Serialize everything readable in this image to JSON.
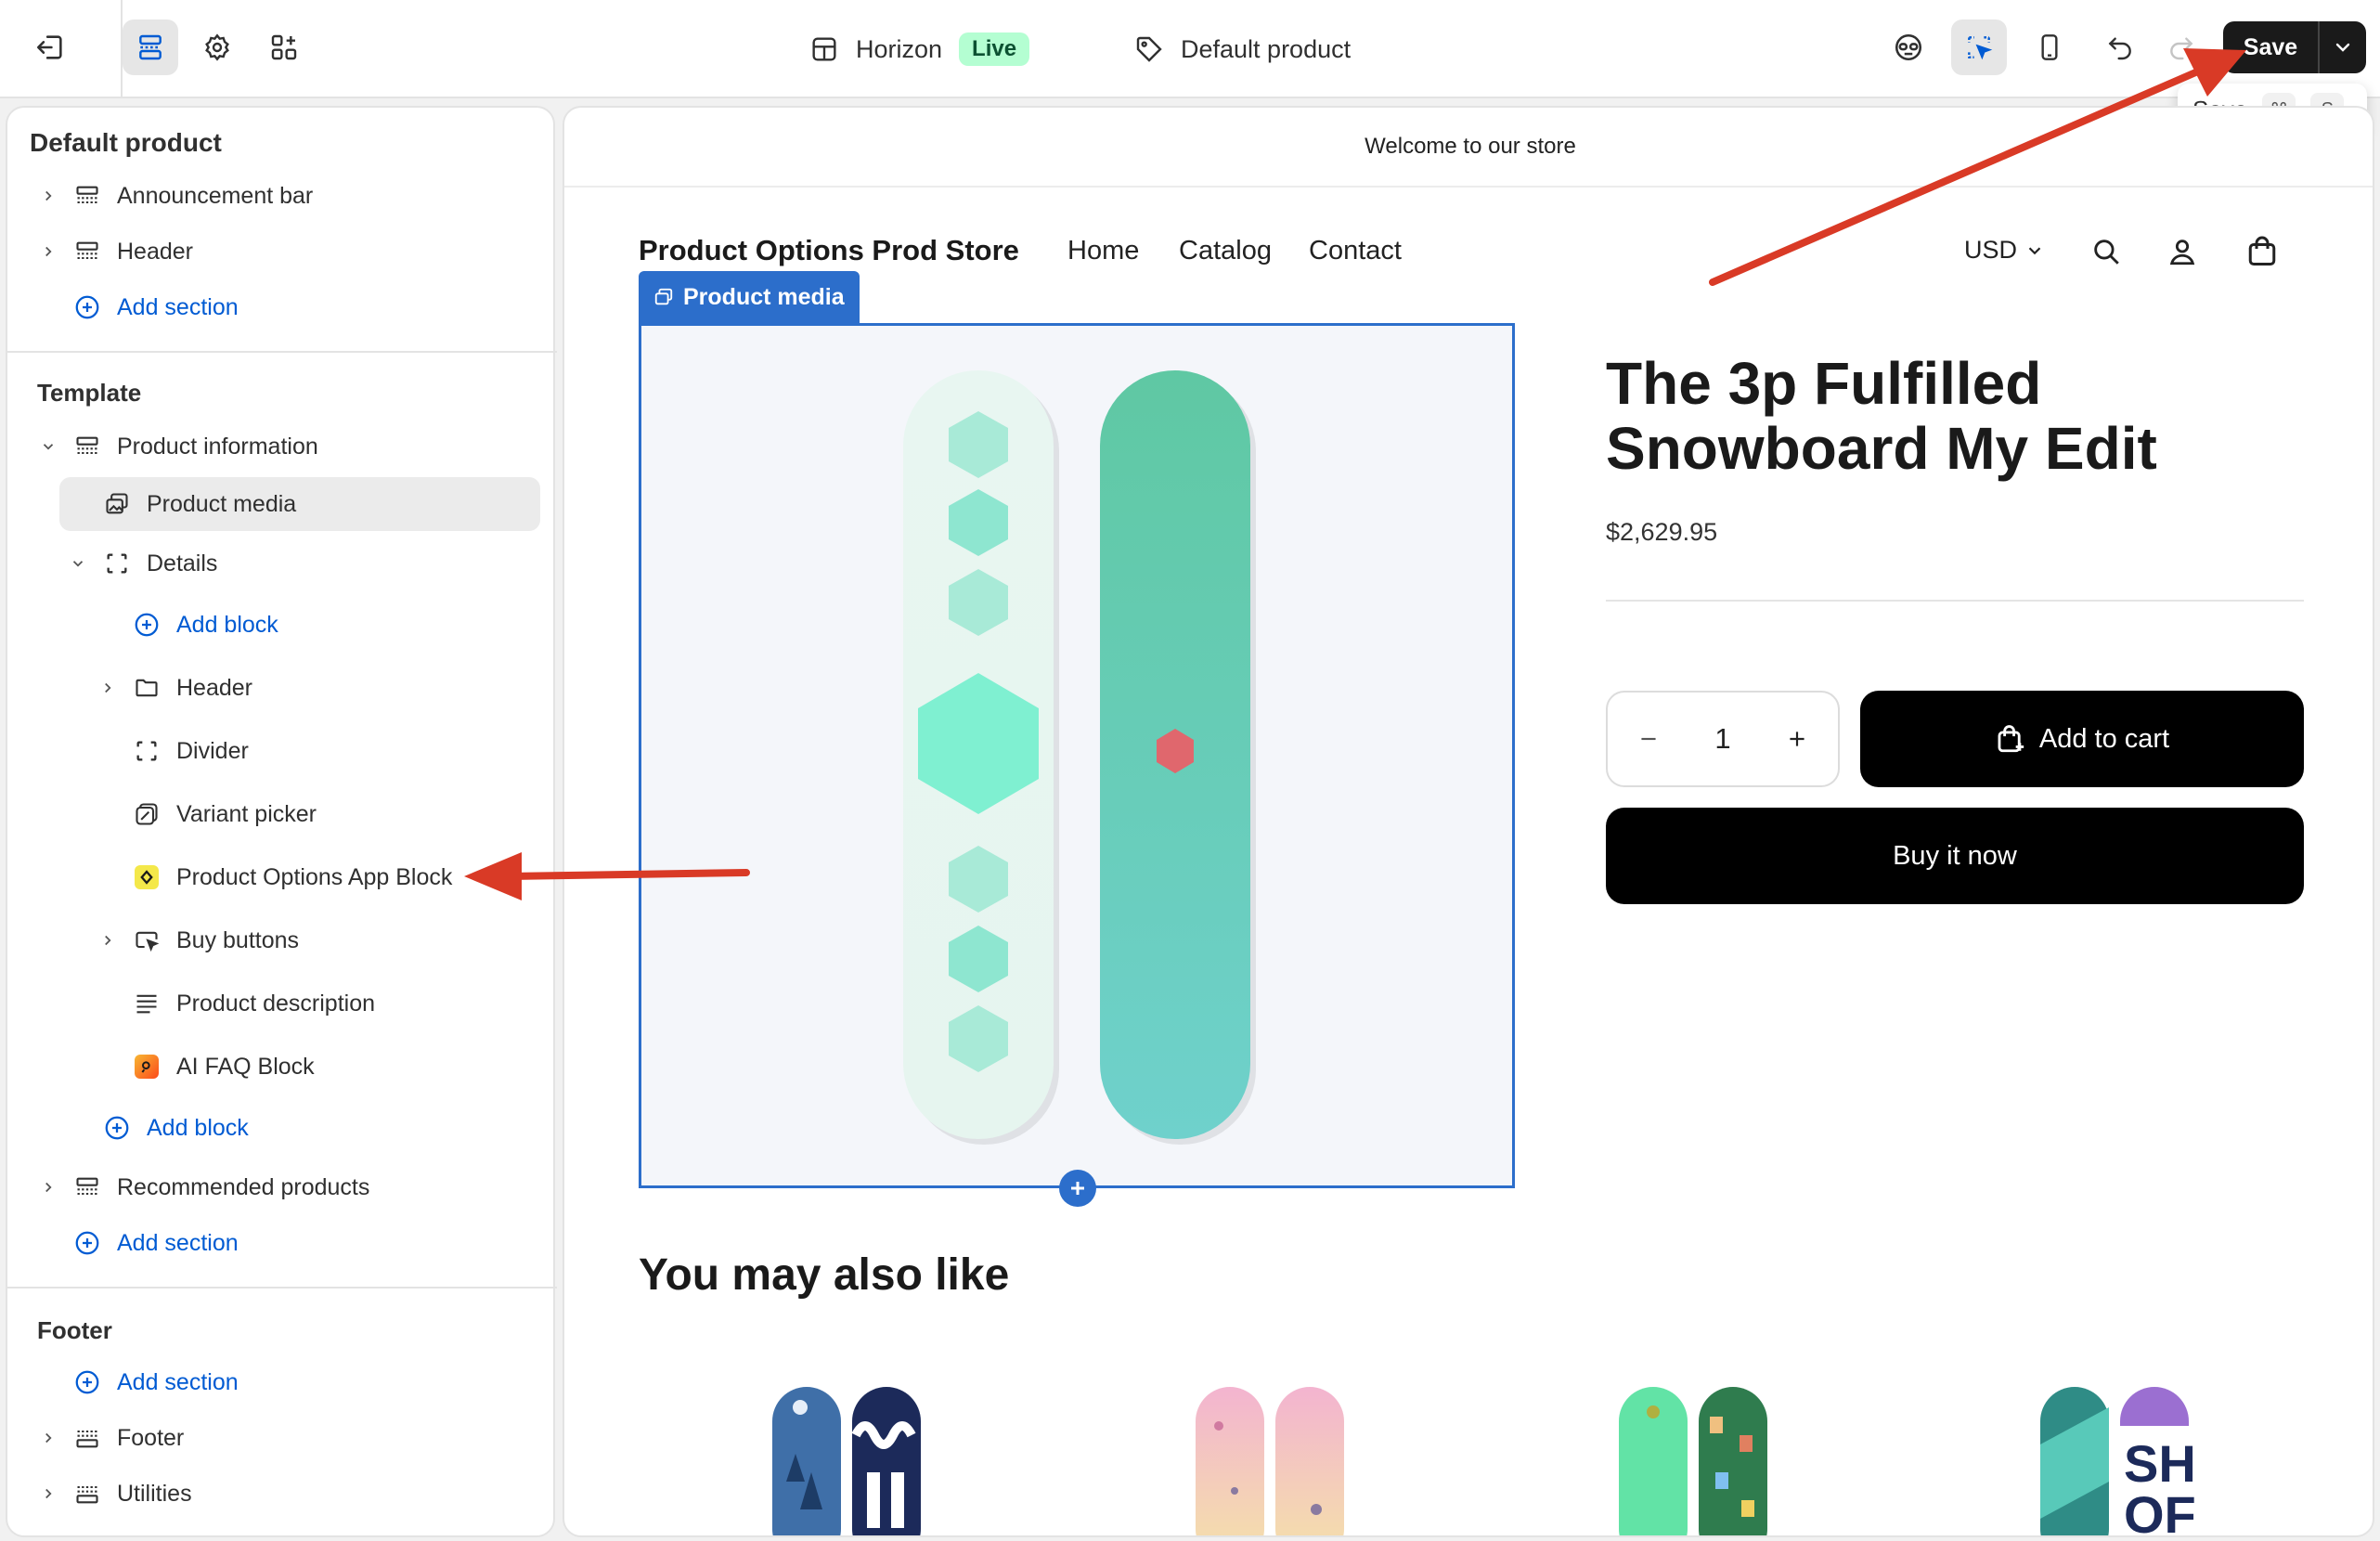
{
  "topbar": {
    "theme_name": "Horizon",
    "theme_status": "Live",
    "template_name": "Default product",
    "save_label": "Save",
    "tooltip": {
      "label": "Save",
      "key_cmd": "⌘",
      "key_s": "S"
    }
  },
  "sidebar": {
    "title": "Default product",
    "header_group": {
      "items": [
        {
          "label": "Announcement bar"
        },
        {
          "label": "Header"
        }
      ],
      "add_label": "Add section"
    },
    "template": {
      "heading": "Template",
      "product_information": "Product information",
      "product_media": "Product media",
      "details": "Details",
      "add_block_inner": "Add block",
      "blocks": [
        {
          "label": "Header"
        },
        {
          "label": "Divider"
        },
        {
          "label": "Variant picker"
        },
        {
          "label": "Product Options App Block"
        },
        {
          "label": "Buy buttons"
        },
        {
          "label": "Product description"
        },
        {
          "label": "AI FAQ Block"
        }
      ],
      "add_block_outer": "Add block",
      "recommended": "Recommended products",
      "add_label": "Add section"
    },
    "footer": {
      "heading": "Footer",
      "add_label": "Add section",
      "items": [
        {
          "label": "Footer"
        },
        {
          "label": "Utilities"
        }
      ]
    }
  },
  "preview": {
    "announcement": "Welcome to our store",
    "store_name": "Product Options Prod Store",
    "nav": [
      "Home",
      "Catalog",
      "Contact"
    ],
    "currency": "USD",
    "media_tag": "Product media",
    "product": {
      "title": "The 3p Fulfilled Snowboard My Edit",
      "price": "$2,629.95",
      "quantity": "1",
      "add_to_cart": "Add to cart",
      "buy_now": "Buy it now"
    },
    "recommended_heading": "You may also like"
  },
  "colors": {
    "accent_blue": "#2c6ecb",
    "link_blue": "#005bd3",
    "live_green": "#b4fed2",
    "annotation_red": "#d93a26"
  }
}
